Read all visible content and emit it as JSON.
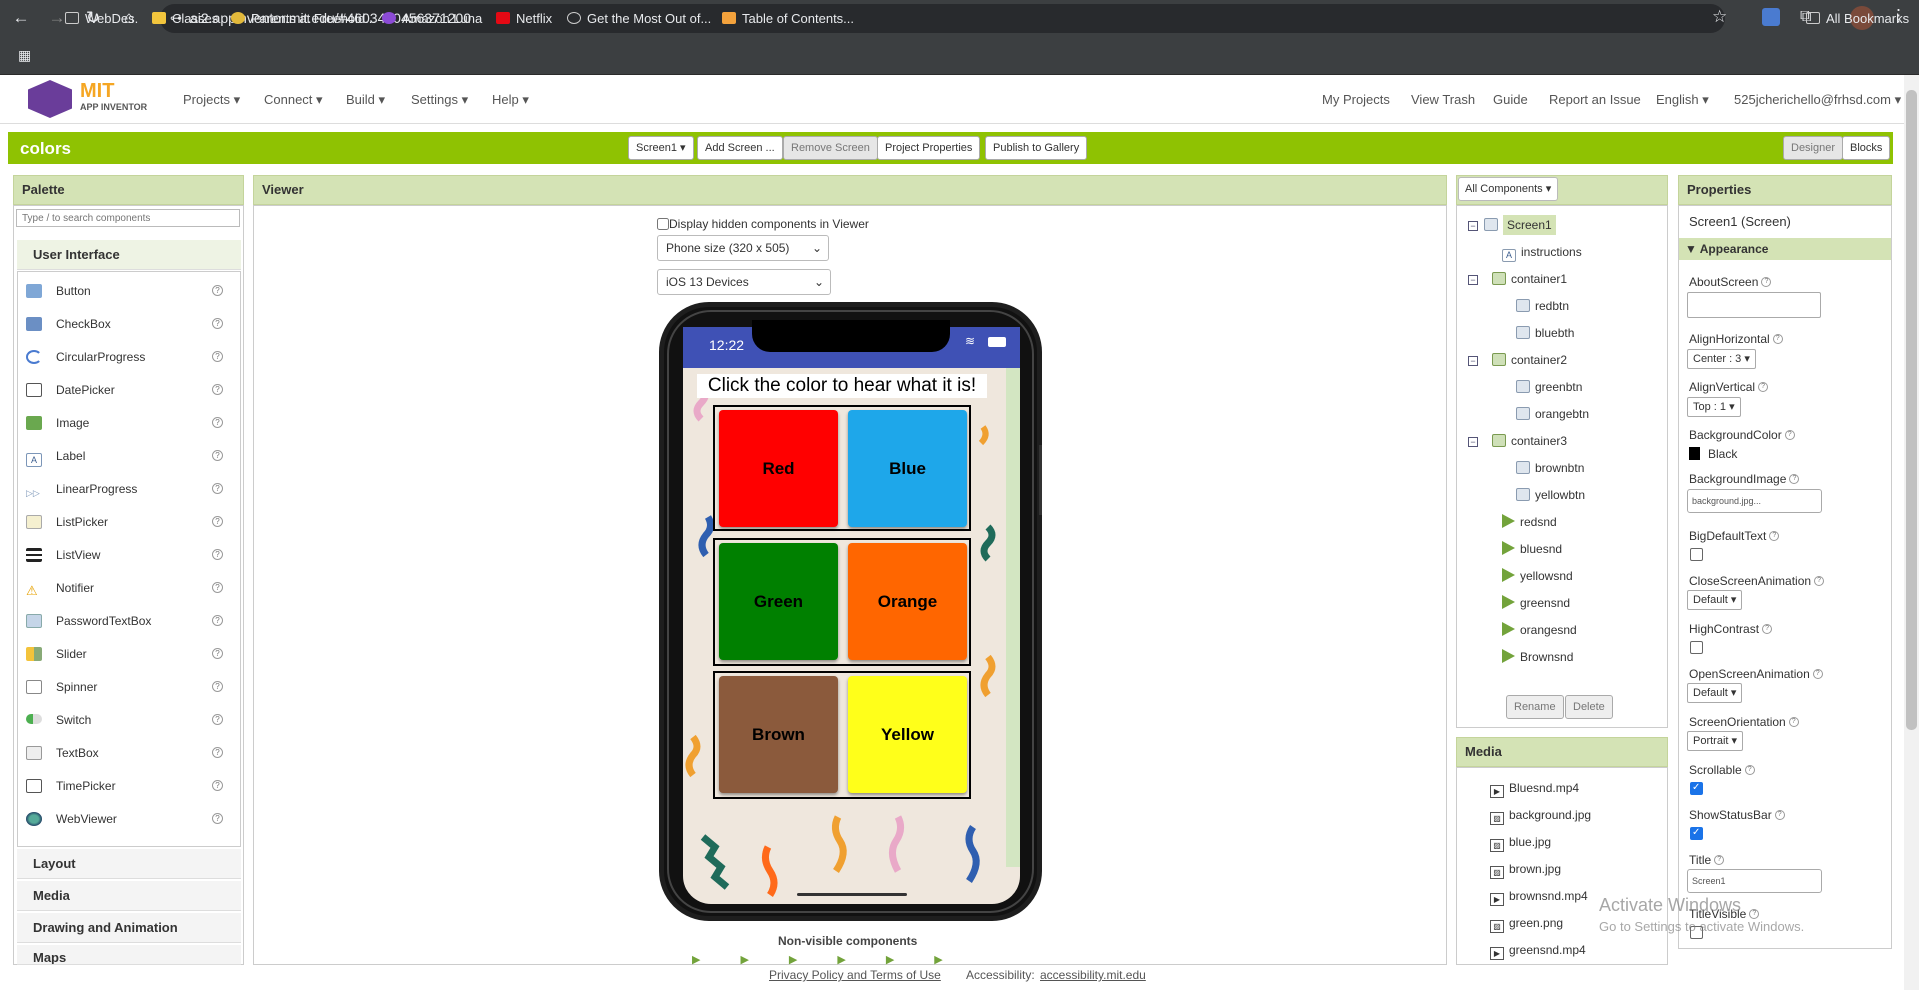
{
  "browser": {
    "url": "ai2.appinventor.mit.edu/#4603490456371200",
    "bookmarks": [
      "WebDes.",
      "Classes",
      "Parents at Freehold...",
      "Amazon Luna",
      "Netflix",
      "Get the Most Out of...",
      "Table of Contents..."
    ],
    "all_bookmarks": "All Bookmarks"
  },
  "header": {
    "logo_title": "MIT",
    "logo_sub": "APP INVENTOR",
    "menus": [
      "Projects",
      "Connect",
      "Build",
      "Settings",
      "Help"
    ],
    "right_links": [
      "My Projects",
      "View Trash",
      "Guide",
      "Report an Issue",
      "English",
      "525jcherichello@frhsd.com"
    ]
  },
  "toolbar": {
    "project_name": "colors",
    "screen_select": "Screen1",
    "add_screen": "Add Screen ...",
    "remove_screen": "Remove Screen",
    "project_properties": "Project Properties",
    "publish": "Publish to Gallery",
    "designer": "Designer",
    "blocks": "Blocks"
  },
  "palette": {
    "title": "Palette",
    "search_placeholder": "Type / to search components",
    "category": "User Interface",
    "items": [
      "Button",
      "CheckBox",
      "CircularProgress",
      "DatePicker",
      "Image",
      "Label",
      "LinearProgress",
      "ListPicker",
      "ListView",
      "Notifier",
      "PasswordTextBox",
      "Slider",
      "Spinner",
      "Switch",
      "TextBox",
      "TimePicker",
      "WebViewer"
    ],
    "other_categories": [
      "Layout",
      "Media",
      "Drawing and Animation",
      "Maps"
    ]
  },
  "viewer": {
    "title": "Viewer",
    "hidden_label": "Display hidden components in Viewer",
    "size_select": "Phone size (320 x 505)",
    "device_select": "iOS 13 Devices",
    "time": "12:22",
    "instructions": "Click the color to hear what it is!",
    "buttons": [
      {
        "label": "Red",
        "color": "#ff0000"
      },
      {
        "label": "Blue",
        "color": "#1ea7ea"
      },
      {
        "label": "Green",
        "color": "#008000"
      },
      {
        "label": "Orange",
        "color": "#ff6600"
      },
      {
        "label": "Brown",
        "color": "#8b5a3c"
      },
      {
        "label": "Yellow",
        "color": "#ffff1a"
      }
    ],
    "nonvisible": "Non-visible components"
  },
  "components": {
    "dropdown": "All Components",
    "tree": [
      "Screen1",
      "instructions",
      "container1",
      "redbtn",
      "bluebth",
      "container2",
      "greenbtn",
      "orangebtn",
      "container3",
      "brownbtn",
      "yellowbtn",
      "redsnd",
      "bluesnd",
      "yellowsnd",
      "greensnd",
      "orangesnd",
      "Brownsnd"
    ],
    "rename": "Rename",
    "delete": "Delete"
  },
  "media": {
    "title": "Media",
    "files": [
      "Bluesnd.mp4",
      "background.jpg",
      "blue.jpg",
      "brown.jpg",
      "brownsnd.mp4",
      "green.png",
      "greensnd.mp4"
    ]
  },
  "properties": {
    "title": "Properties",
    "subject": "Screen1 (Screen)",
    "section": "Appearance",
    "about_label": "AboutScreen",
    "align_h_label": "AlignHorizontal",
    "align_h_value": "Center : 3",
    "align_v_label": "AlignVertical",
    "align_v_value": "Top : 1",
    "bg_color_label": "BackgroundColor",
    "bg_color_value": "Black",
    "bg_image_label": "BackgroundImage",
    "bg_image_value": "background.jpg...",
    "big_text_label": "BigDefaultText",
    "close_anim_label": "CloseScreenAnimation",
    "close_anim_value": "Default",
    "high_contrast_label": "HighContrast",
    "open_anim_label": "OpenScreenAnimation",
    "open_anim_value": "Default",
    "orientation_label": "ScreenOrientation",
    "orientation_value": "Portrait",
    "scrollable_label": "Scrollable",
    "statusbar_label": "ShowStatusBar",
    "title_label": "Title",
    "title_value": "Screen1",
    "title_visible_label": "TitleVisible"
  },
  "footer": {
    "privacy": "Privacy Policy and Terms of Use",
    "accessibility_label": "Accessibility:",
    "accessibility_link": "accessibility.mit.edu"
  },
  "watermark": {
    "line1": "Activate Windows",
    "line2": "Go to Settings to activate Windows."
  }
}
